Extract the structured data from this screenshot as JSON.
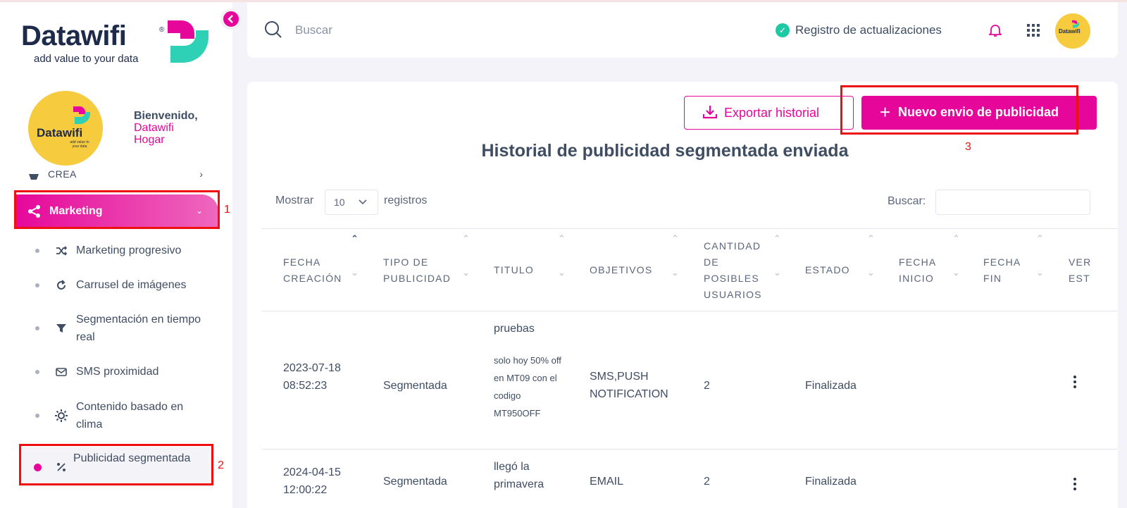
{
  "brand": {
    "name": "Datawifi",
    "registered": "®",
    "tagline": "add value to your data",
    "avatar_tagline": "add value to your data",
    "colors": {
      "accent": "#e6079a",
      "teal": "#2ed1b5",
      "avatar_bg": "#f6cb3e",
      "navy": "#1e2a4a"
    }
  },
  "topbar": {
    "search_placeholder": "Buscar",
    "updates_label": "Registro de actualizaciones",
    "icons": [
      "search-icon",
      "check-circle-icon",
      "bell-icon",
      "apps-grid-icon"
    ]
  },
  "sidebar": {
    "welcome_title": "Bienvenido,",
    "welcome_name": "Datawifi Hogar",
    "crea_label": "CREA",
    "crea_chevron": "›",
    "marketing_label": "Marketing",
    "marketing_chevron": "⌄",
    "items": [
      {
        "label": "Marketing progresivo",
        "icon": "shuffle-icon"
      },
      {
        "label": "Carrusel de imágenes",
        "icon": "refresh-icon"
      },
      {
        "label": "Segmentación en tiempo real",
        "icon": "filter-icon"
      },
      {
        "label": "SMS proximidad",
        "icon": "mail-icon"
      },
      {
        "label": "Contenido basado en clima",
        "icon": "sun-icon"
      },
      {
        "label": "Publicidad segmentada",
        "icon": "percent-icon",
        "active": true
      }
    ]
  },
  "annotations": [
    "1",
    "2",
    "3"
  ],
  "main": {
    "export_label": "Exportar historial",
    "new_label": "Nuevo envio de publicidad",
    "new_plus": "+",
    "title": "Historial de publicidad segmentada enviada",
    "show_label": "Mostrar",
    "page_size": "10",
    "records_label": "registros",
    "find_label": "Buscar:",
    "columns": [
      "FECHA CREACIÓN",
      "TIPO DE PUBLICIDAD",
      "TITULO",
      "OBJETIVOS",
      "CANTIDAD DE POSIBLES USUARIOS",
      "ESTADO",
      "FECHA INICIO",
      "FECHA FIN",
      "VER EST"
    ],
    "rows": [
      {
        "fecha": "2023-07-18 08:52:23",
        "tipo": "Segmentada",
        "titulo": "pruebas",
        "descripcion": "solo hoy 50% off en MT09 con el codigo MT950OFF",
        "objetivos": "SMS,PUSH NOTIFICATION",
        "cantidad": "2",
        "estado": "Finalizada",
        "inicio": "",
        "fin": ""
      },
      {
        "fecha": "2024-04-15 12:00:22",
        "tipo": "Segmentada",
        "titulo": "llegó la primavera",
        "descripcion": "",
        "objetivos": "EMAIL",
        "cantidad": "2",
        "estado": "Finalizada",
        "inicio": "",
        "fin": ""
      }
    ]
  }
}
